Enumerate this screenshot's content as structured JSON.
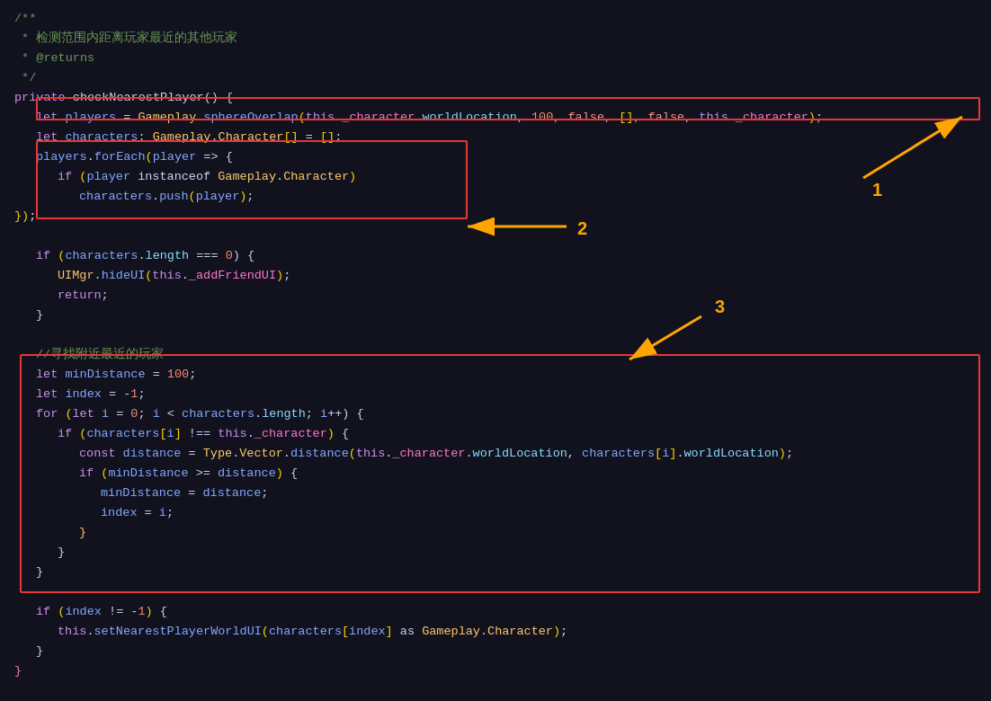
{
  "code": {
    "lines": [
      {
        "id": 1,
        "content": "comment_block_start"
      },
      {
        "id": 2,
        "content": "comment_chinese1"
      },
      {
        "id": 3,
        "content": "comment_returns"
      },
      {
        "id": 4,
        "content": "comment_block_end"
      },
      {
        "id": 5,
        "content": "private_decl"
      },
      {
        "id": 6,
        "content": "let_players"
      },
      {
        "id": 7,
        "content": "let_characters"
      },
      {
        "id": 8,
        "content": "players_foreach"
      },
      {
        "id": 9,
        "content": "if_player_instanceof"
      },
      {
        "id": 10,
        "content": "characters_push"
      },
      {
        "id": 11,
        "content": "close_brace"
      },
      {
        "id": 12,
        "content": "empty"
      },
      {
        "id": 13,
        "content": "if_characters_length"
      },
      {
        "id": 14,
        "content": "uimgr_hide"
      },
      {
        "id": 15,
        "content": "return_stmt"
      },
      {
        "id": 16,
        "content": "close_brace2"
      },
      {
        "id": 17,
        "content": "empty2"
      },
      {
        "id": 18,
        "content": "comment_find"
      },
      {
        "id": 19,
        "content": "let_minDistance"
      },
      {
        "id": 20,
        "content": "let_index"
      },
      {
        "id": 21,
        "content": "for_loop"
      },
      {
        "id": 22,
        "content": "if_characters_i"
      },
      {
        "id": 23,
        "content": "const_distance"
      },
      {
        "id": 24,
        "content": "if_minDistance"
      },
      {
        "id": 25,
        "content": "minDistance_eq"
      },
      {
        "id": 26,
        "content": "index_eq_i"
      },
      {
        "id": 27,
        "content": "close_inner"
      },
      {
        "id": 28,
        "content": "close_if"
      },
      {
        "id": 29,
        "content": "close_for"
      },
      {
        "id": 30,
        "content": "empty3"
      },
      {
        "id": 31,
        "content": "if_index"
      },
      {
        "id": 32,
        "content": "set_nearest"
      },
      {
        "id": 33,
        "content": "close_last"
      }
    ],
    "annotations": {
      "label1": "1",
      "label2": "2",
      "label3": "3"
    }
  }
}
